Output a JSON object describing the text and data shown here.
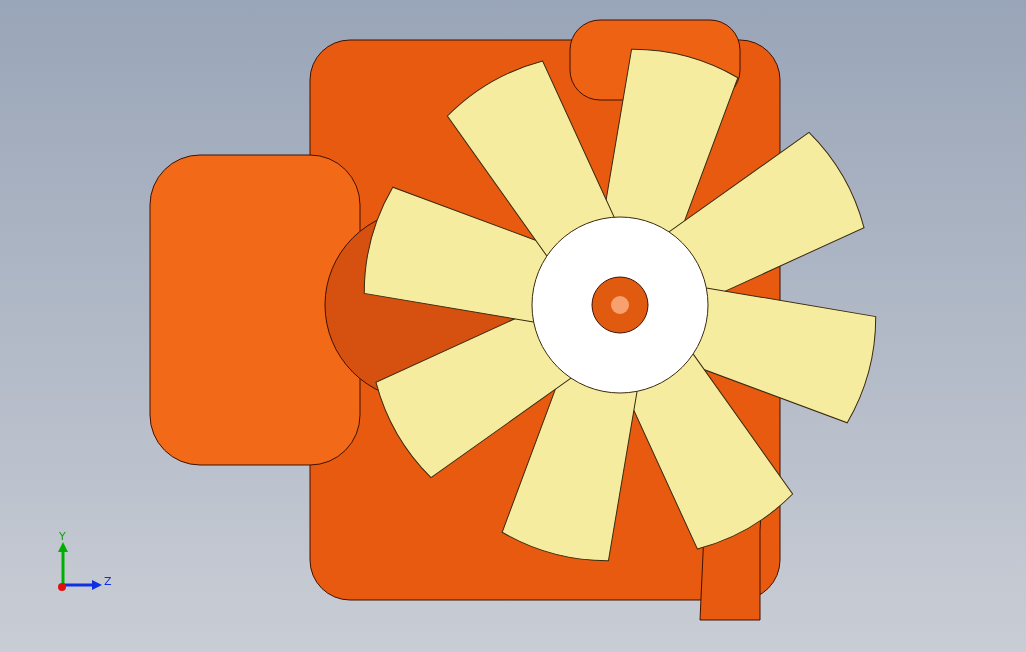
{
  "viewport": {
    "axis_triad": [
      {
        "label": "Y",
        "color": "#00b000"
      },
      {
        "label": "Z",
        "color": "#1030e0"
      }
    ]
  }
}
